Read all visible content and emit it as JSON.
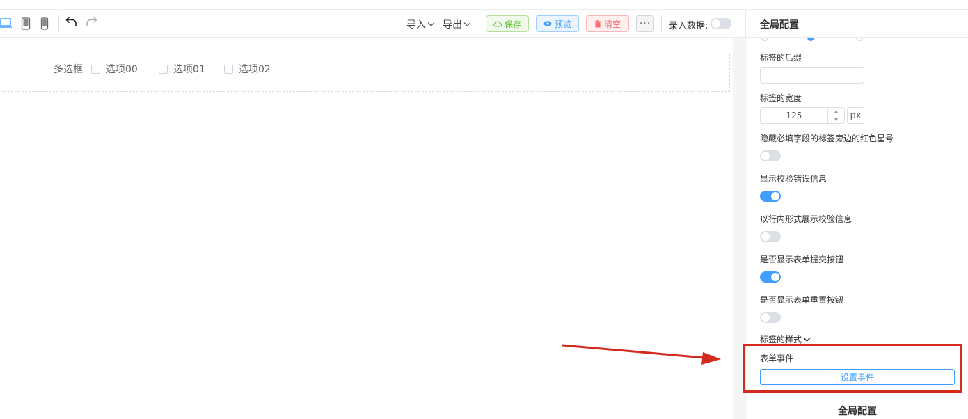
{
  "toolbar": {
    "import_label": "导入",
    "export_label": "导出",
    "save_label": "保存",
    "preview_label": "预览",
    "clear_label": "清空",
    "more_label": "···",
    "entry_data_label": "录入数据:"
  },
  "canvas": {
    "field_label": "多选框",
    "options": [
      "选项00",
      "选项01",
      "选项02"
    ]
  },
  "panel": {
    "title": "全局配置",
    "label_suffix_label": "标签的后缀",
    "label_suffix_value": "",
    "label_width_label": "标签的宽度",
    "label_width_value": "125",
    "label_width_unit": "px",
    "hide_required_asterisk_label": "隐藏必填字段的标签旁边的红色星号",
    "show_validation_error_label": "显示校验错误信息",
    "inline_validation_label": "以行内形式展示校验信息",
    "show_submit_button_label": "是否显示表单提交按钮",
    "show_reset_button_label": "是否显示表单重置按钮",
    "label_style_label": "标签的样式",
    "form_events_label": "表单事件",
    "set_event_button": "设置事件",
    "section_title": "全局配置"
  },
  "toggles": {
    "entry_data": false,
    "hide_required_asterisk": false,
    "show_validation_error": true,
    "inline_validation": false,
    "show_submit_button": true,
    "show_reset_button": false
  },
  "colors": {
    "accent": "#409eff",
    "success": "#67c23a",
    "danger": "#f56c6c",
    "annotation": "#d42a1e"
  }
}
